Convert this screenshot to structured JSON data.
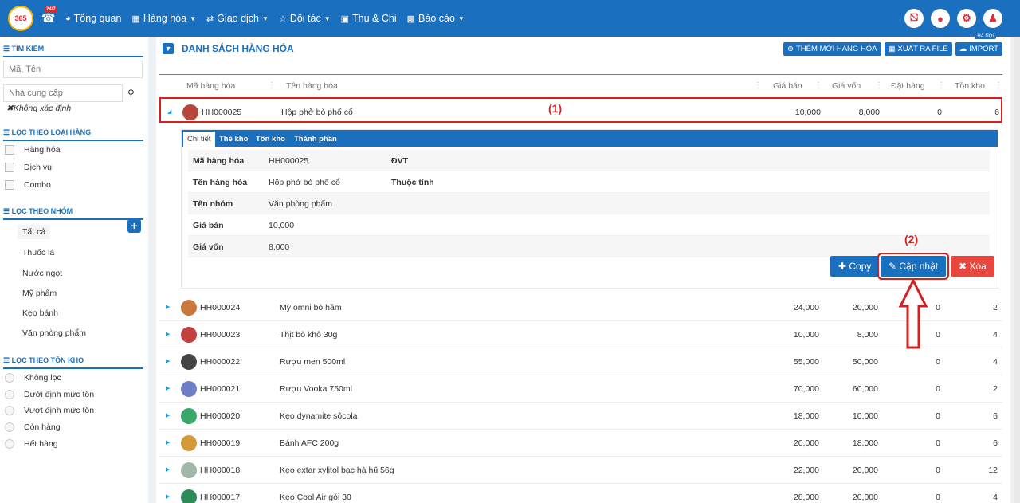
{
  "topbar": {
    "logo_text": "365",
    "hotline_badge": "24/7",
    "nav": [
      {
        "label": "Tổng quan",
        "icon": "dashboard-icon"
      },
      {
        "label": "Hàng hóa",
        "icon": "cubes-icon"
      },
      {
        "label": "Giao dịch",
        "icon": "exchange-icon"
      },
      {
        "label": "Đối tác",
        "icon": "handshake-icon"
      },
      {
        "label": "Thu & Chi",
        "icon": "money-icon"
      },
      {
        "label": "Báo cáo",
        "icon": "bar-chart-icon"
      }
    ],
    "right_icons": [
      "cart-icon",
      "location-icon",
      "settings-icon",
      "user-icon"
    ]
  },
  "sidebar": {
    "search_title": "TÌM KIẾM",
    "search_placeholder": "Mã, Tên",
    "supplier_placeholder": "Nhà cung cấp",
    "unspecified": "Không xác định",
    "type_title": "LỌC THEO LOẠI HÀNG",
    "types": [
      "Hàng hóa",
      "Dịch vụ",
      "Combo"
    ],
    "group_title": "LỌC THEO NHÓM",
    "groups": [
      "Tất cả",
      "Thuốc lá",
      "Nước ngọt",
      "Mỹ phẩm",
      "Kẹo bánh",
      "Văn phòng phẩm"
    ],
    "stock_title": "LỌC THEO TỒN KHO",
    "stock_filters": [
      "Không lọc",
      "Dưới định mức tồn",
      "Vượt định mức tồn",
      "Còn hàng",
      "Hết hàng"
    ]
  },
  "main": {
    "title": "DANH SÁCH HÀNG HÓA",
    "buttons": {
      "add": "THÊM MỚI HÀNG HÓA",
      "export": "XUẤT RA FILE",
      "import": "IMPORT"
    },
    "location_tag": "HÀ NỘI",
    "columns": [
      "Mã hàng hóa",
      "Tên hàng hóa",
      "Giá bán",
      "Giá vốn",
      "Đặt hàng",
      "Tồn kho"
    ],
    "selected_row": {
      "code": "HH000025",
      "name": "Hộp phở bò phố cổ",
      "price": "10,000",
      "cost": "8,000",
      "ordered": "0",
      "stock": "6"
    },
    "annotation_1": "(1)",
    "annotation_2": "(2)",
    "detail": {
      "tabs": [
        "Chi tiết",
        "Thẻ kho",
        "Tồn kho",
        "Thành phần"
      ],
      "fields": [
        {
          "label": "Mã hàng hóa",
          "value": "HH000025",
          "label2": "ĐVT"
        },
        {
          "label": "Tên hàng hóa",
          "value": "Hộp phở bò phố cổ",
          "label2": "Thuộc tính"
        },
        {
          "label": "Tên nhóm",
          "value": "Văn phòng phẩm",
          "label2": ""
        },
        {
          "label": "Giá bán",
          "value": "10,000",
          "label2": ""
        },
        {
          "label": "Giá vốn",
          "value": "8,000",
          "label2": ""
        }
      ],
      "btn_copy": "Copy",
      "btn_update": "Cập nhật",
      "btn_delete": "Xóa"
    },
    "rows": [
      {
        "code": "HH000024",
        "name": "Mỳ omni bò hầm",
        "price": "24,000",
        "cost": "20,000",
        "ordered": "0",
        "stock": "2"
      },
      {
        "code": "HH000023",
        "name": "Thịt bò khô 30g",
        "price": "10,000",
        "cost": "8,000",
        "ordered": "0",
        "stock": "4"
      },
      {
        "code": "HH000022",
        "name": "Rượu men 500ml",
        "price": "55,000",
        "cost": "50,000",
        "ordered": "0",
        "stock": "4"
      },
      {
        "code": "HH000021",
        "name": "Rượu Vooka 750ml",
        "price": "70,000",
        "cost": "60,000",
        "ordered": "0",
        "stock": "2"
      },
      {
        "code": "HH000020",
        "name": "Kẹo dynamite sôcola",
        "price": "18,000",
        "cost": "10,000",
        "ordered": "0",
        "stock": "6"
      },
      {
        "code": "HH000019",
        "name": "Bánh AFC 200g",
        "price": "20,000",
        "cost": "18,000",
        "ordered": "0",
        "stock": "6"
      },
      {
        "code": "HH000018",
        "name": "Kẹo extar xylitol bạc hà hũ 56g",
        "price": "22,000",
        "cost": "20,000",
        "ordered": "0",
        "stock": "12"
      },
      {
        "code": "HH000017",
        "name": "Kẹo Cool Air gói 30",
        "price": "28,000",
        "cost": "20,000",
        "ordered": "0",
        "stock": "4"
      }
    ]
  }
}
